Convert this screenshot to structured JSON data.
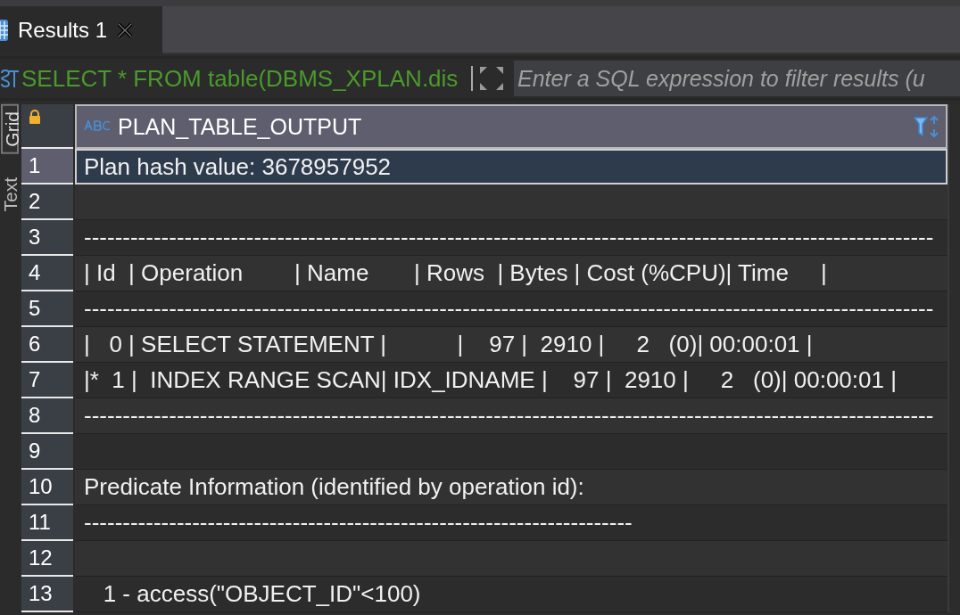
{
  "tab": {
    "label": "Results 1"
  },
  "query": "SELECT * FROM table(DBMS_XPLAN.dis",
  "filter": {
    "placeholder": "Enter a SQL expression to filter results (u"
  },
  "view_tabs": [
    {
      "label": "Grid",
      "selected": true
    },
    {
      "label": "Text",
      "selected": false
    }
  ],
  "column": {
    "name": "PLAN_TABLE_OUTPUT"
  },
  "rows": [
    {
      "number": "1",
      "text": "Plan hash value: 3678957952",
      "selected": true
    },
    {
      "number": "2",
      "text": "",
      "selected": false
    },
    {
      "number": "3",
      "text": "--------------------------------------------------------------------------------------------------------------",
      "selected": false
    },
    {
      "number": "4",
      "text": "| Id  | Operation        | Name       | Rows  | Bytes | Cost (%CPU)| Time     |",
      "selected": false
    },
    {
      "number": "5",
      "text": "--------------------------------------------------------------------------------------------------------------",
      "selected": false
    },
    {
      "number": "6",
      "text": "|   0 | SELECT STATEMENT |           |    97 |  2910 |     2   (0)| 00:00:01 |",
      "selected": false
    },
    {
      "number": "7",
      "text": "|*  1 |  INDEX RANGE SCAN| IDX_IDNAME |    97 |  2910 |     2   (0)| 00:00:01 |",
      "selected": false
    },
    {
      "number": "8",
      "text": "--------------------------------------------------------------------------------------------------------------",
      "selected": false
    },
    {
      "number": "9",
      "text": "",
      "selected": false
    },
    {
      "number": "10",
      "text": "Predicate Information (identified by operation id):",
      "selected": false
    },
    {
      "number": "11",
      "text": "-----------------------------------------------------------------------",
      "selected": false
    },
    {
      "number": "12",
      "text": "",
      "selected": false
    },
    {
      "number": "13",
      "text": "   1 - access(\"OBJECT_ID\"<100)",
      "selected": false
    }
  ]
}
